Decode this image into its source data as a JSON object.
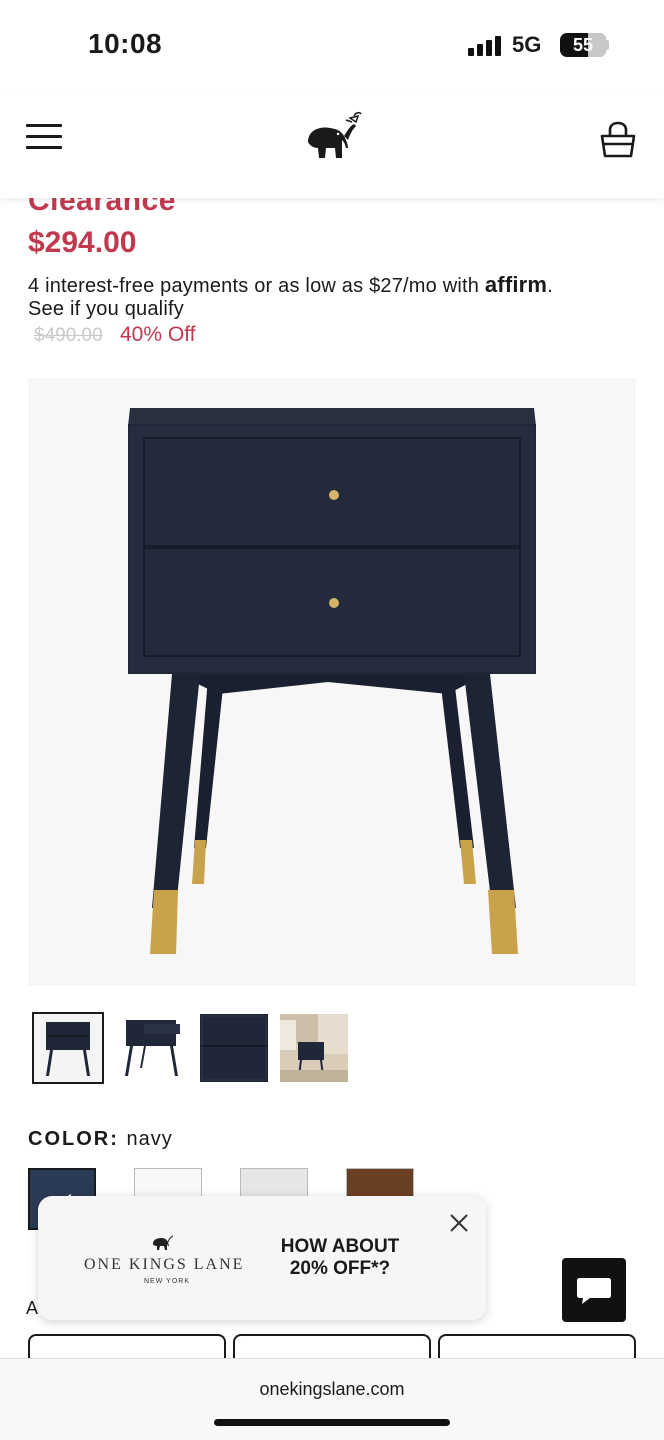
{
  "status": {
    "time": "10:08",
    "network": "5G",
    "battery": "55"
  },
  "header": {
    "menu_icon": "hamburger-menu-icon",
    "logo_icon": "elephant-logo-icon",
    "cart_icon": "shopping-basket-icon"
  },
  "product": {
    "badge": "Clearance",
    "price": "$294.00",
    "affirm_text": "4 interest-free payments or as low as $27/mo with ",
    "affirm_brand": "affirm",
    "affirm_suffix": ".",
    "qualify_link": "See if you qualify",
    "original_price": "$490.00",
    "discount": "40% Off"
  },
  "color": {
    "label": "COLOR:",
    "selected": "navy",
    "swatches": [
      "#2b3a55",
      "#f8f8f6",
      "#e6e6e4",
      "#6b3f24"
    ]
  },
  "size": {
    "label": "A"
  },
  "promo": {
    "brand": "ONE KINGS LANE",
    "city": "NEW YORK",
    "headline": "HOW ABOUT 20% OFF*?"
  },
  "browser": {
    "url": "onekingslane.com"
  },
  "colors": {
    "accent": "#c0394e",
    "navy": "#1f2738"
  }
}
